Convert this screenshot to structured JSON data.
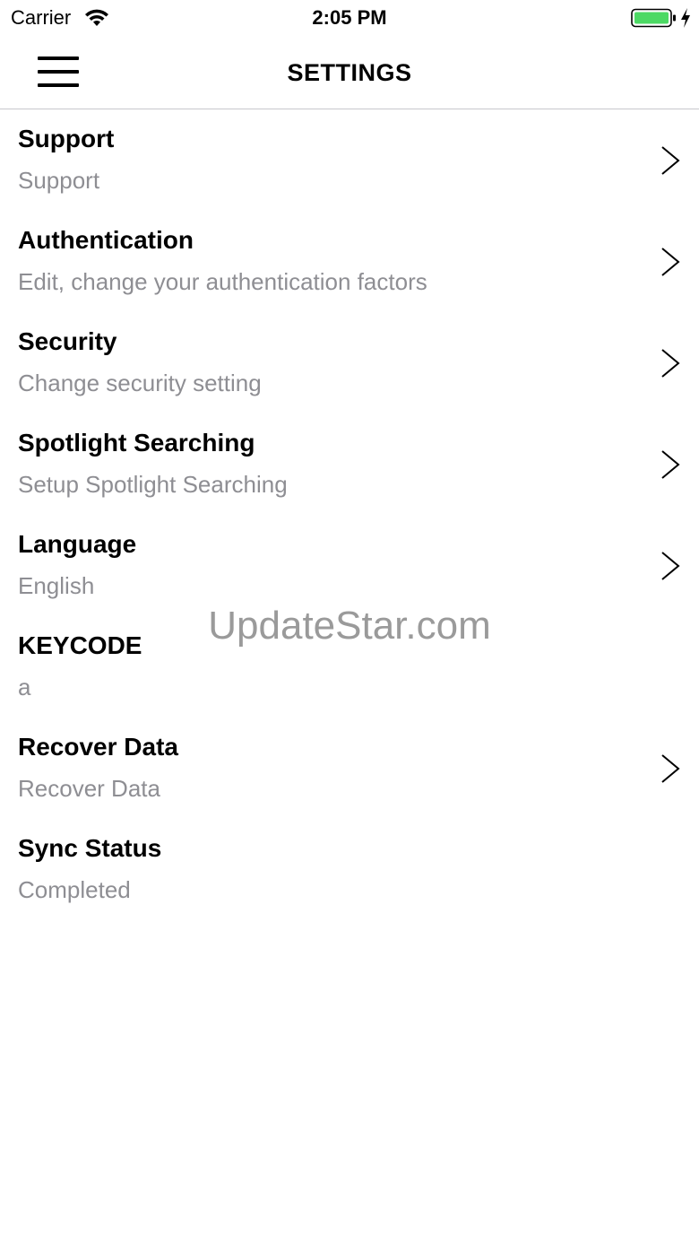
{
  "status_bar": {
    "carrier": "Carrier",
    "time": "2:05 PM",
    "wifi_icon": "wifi-icon",
    "battery_icon": "battery-icon",
    "charging_icon": "bolt-icon",
    "battery_color": "#4cd964"
  },
  "nav": {
    "title": "SETTINGS",
    "menu_icon": "hamburger-icon"
  },
  "rows": [
    {
      "title": "Support",
      "subtitle": "Support",
      "has_chevron": true
    },
    {
      "title": "Authentication",
      "subtitle": "Edit, change your authentication factors",
      "has_chevron": true
    },
    {
      "title": "Security",
      "subtitle": "Change security setting",
      "has_chevron": true
    },
    {
      "title": "Spotlight Searching",
      "subtitle": "Setup Spotlight Searching",
      "has_chevron": true
    },
    {
      "title": "Language",
      "subtitle": "English",
      "has_chevron": true
    },
    {
      "title": "KEYCODE",
      "subtitle": "a",
      "has_chevron": false
    },
    {
      "title": "Recover Data",
      "subtitle": "Recover Data",
      "has_chevron": true
    },
    {
      "title": "Sync Status",
      "subtitle": "Completed",
      "has_chevron": false
    }
  ],
  "watermark": "UpdateStar.com",
  "colors": {
    "subtitle": "#8e8e93",
    "separator": "#c8c7cc",
    "chevron": "#000000"
  }
}
